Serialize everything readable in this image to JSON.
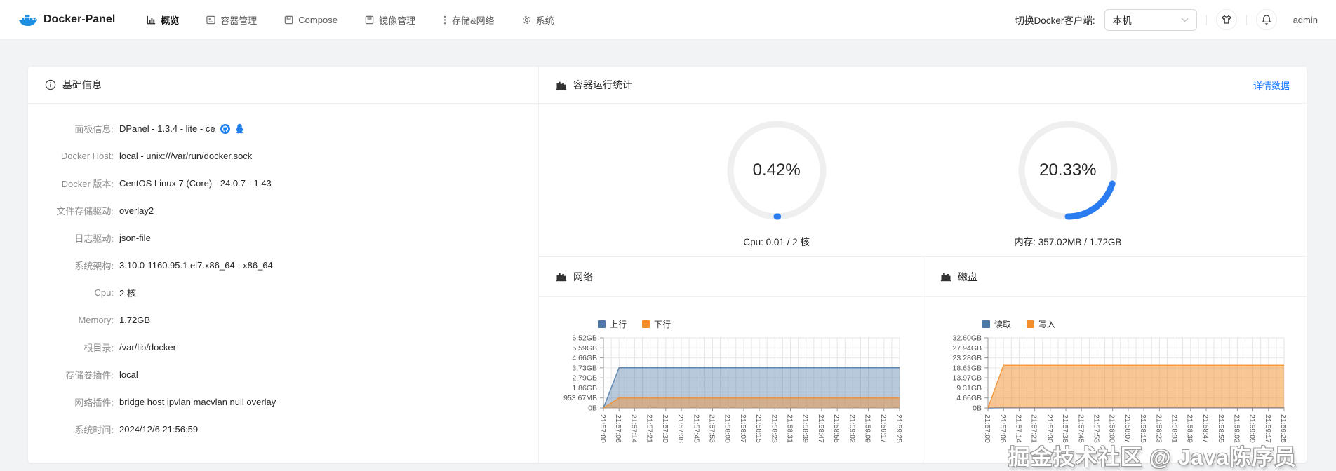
{
  "accent_color": "#1677ff",
  "nav": {
    "brand": "Docker-Panel",
    "items": [
      {
        "label": "概览",
        "icon": "overview-chart-icon",
        "active": true
      },
      {
        "label": "容器管理",
        "icon": "container-icon",
        "active": false
      },
      {
        "label": "Compose",
        "icon": "compose-icon",
        "active": false
      },
      {
        "label": "镜像管理",
        "icon": "image-icon",
        "active": false
      },
      {
        "label": "存储&网络",
        "icon": "storage-network-icon",
        "active": false
      },
      {
        "label": "系统",
        "icon": "gear-icon",
        "active": false
      }
    ],
    "client_switch_label": "切换Docker客户端:",
    "client_selected": "本机",
    "username": "admin"
  },
  "basic_info": {
    "title": "基础信息",
    "rows": [
      {
        "label": "面板信息:",
        "value": "DPanel - 1.3.4 - lite - ce",
        "icons": [
          "github-icon",
          "qq-icon"
        ]
      },
      {
        "label": "Docker Host:",
        "value": "local - unix:///var/run/docker.sock"
      },
      {
        "label": "Docker 版本:",
        "value": "CentOS Linux 7 (Core) - 24.0.7 - 1.43"
      },
      {
        "label": "文件存储驱动:",
        "value": "overlay2"
      },
      {
        "label": "日志驱动:",
        "value": "json-file"
      },
      {
        "label": "系统架构:",
        "value": "3.10.0-1160.95.1.el7.x86_64 - x86_64"
      },
      {
        "label": "Cpu:",
        "value": "2 核"
      },
      {
        "label": "Memory:",
        "value": "1.72GB"
      },
      {
        "label": "根目录:",
        "value": "/var/lib/docker"
      },
      {
        "label": "存储卷插件:",
        "value": "local"
      },
      {
        "label": "网络插件:",
        "value": "bridge host ipvlan macvlan null overlay"
      },
      {
        "label": "系统时间:",
        "value": "2024/12/6 21:56:59"
      }
    ]
  },
  "stats": {
    "title": "容器运行统计",
    "detail_link": "详情数据",
    "gauge_color": "#2b7cf0",
    "gauge_track_color": "#efefef",
    "gauges": [
      {
        "percent_label": "0.42%",
        "percent": 0.42,
        "caption": "Cpu: 0.01 / 2 核"
      },
      {
        "percent_label": "20.33%",
        "percent": 20.33,
        "caption": "内存: 357.02MB / 1.72GB"
      }
    ]
  },
  "chart_data": [
    {
      "type": "area",
      "panel_title": "网络",
      "legend": [
        "上行",
        "下行"
      ],
      "colors": [
        "#4e79a7",
        "#f28e2b"
      ],
      "fill_opacity": [
        0.4,
        0.45
      ],
      "x": [
        "21:57:00",
        "21:57:06",
        "21:57:14",
        "21:57:21",
        "21:57:30",
        "21:57:38",
        "21:57:45",
        "21:57:53",
        "21:58:00",
        "21:58:07",
        "21:58:15",
        "21:58:23",
        "21:58:31",
        "21:58:39",
        "21:58:47",
        "21:58:55",
        "21:59:02",
        "21:59:09",
        "21:59:17",
        "21:59:25"
      ],
      "ytick_labels": [
        "6.52GB",
        "5.59GB",
        "4.66GB",
        "3.73GB",
        "2.79GB",
        "1.86GB",
        "953.67MB",
        "0B"
      ],
      "ylim_gb": [
        0,
        6.52
      ],
      "grid": true,
      "legend_position": "top-left",
      "series": [
        {
          "name": "上行",
          "values_gb": [
            0,
            3.73,
            3.73,
            3.73,
            3.73,
            3.73,
            3.73,
            3.73,
            3.73,
            3.73,
            3.73,
            3.73,
            3.73,
            3.73,
            3.73,
            3.73,
            3.73,
            3.73,
            3.73,
            3.73
          ]
        },
        {
          "name": "下行",
          "values_gb": [
            0,
            0.93,
            0.93,
            0.93,
            0.93,
            0.93,
            0.93,
            0.93,
            0.93,
            0.93,
            0.93,
            0.93,
            0.93,
            0.93,
            0.93,
            0.93,
            0.93,
            0.93,
            0.93,
            0.93
          ]
        }
      ]
    },
    {
      "type": "area",
      "panel_title": "磁盘",
      "legend": [
        "读取",
        "写入"
      ],
      "colors": [
        "#4e79a7",
        "#f28e2b"
      ],
      "fill_opacity": [
        0.4,
        0.5
      ],
      "x": [
        "21:57:00",
        "21:57:06",
        "21:57:14",
        "21:57:21",
        "21:57:30",
        "21:57:38",
        "21:57:45",
        "21:57:53",
        "21:58:00",
        "21:58:07",
        "21:58:15",
        "21:58:23",
        "21:58:31",
        "21:58:39",
        "21:58:47",
        "21:58:55",
        "21:59:02",
        "21:59:09",
        "21:59:17",
        "21:59:25"
      ],
      "ytick_labels": [
        "32.60GB",
        "27.94GB",
        "23.28GB",
        "18.63GB",
        "13.97GB",
        "9.31GB",
        "4.66GB",
        "0B"
      ],
      "ylim_gb": [
        0,
        32.6
      ],
      "grid": true,
      "legend_position": "top-left",
      "series": [
        {
          "name": "读取",
          "values_gb": [
            0,
            0.12,
            0.12,
            0.12,
            0.12,
            0.12,
            0.12,
            0.12,
            0.12,
            0.12,
            0.12,
            0.12,
            0.12,
            0.12,
            0.12,
            0.12,
            0.12,
            0.12,
            0.12,
            0.12
          ]
        },
        {
          "name": "写入",
          "values_gb": [
            0,
            19.8,
            19.8,
            19.8,
            19.8,
            19.8,
            19.8,
            19.8,
            19.8,
            19.8,
            19.8,
            19.8,
            19.8,
            19.8,
            19.8,
            19.8,
            19.8,
            19.8,
            19.8,
            19.8
          ]
        }
      ]
    }
  ],
  "watermark": "掘金技术社区 @ Java陈序员"
}
